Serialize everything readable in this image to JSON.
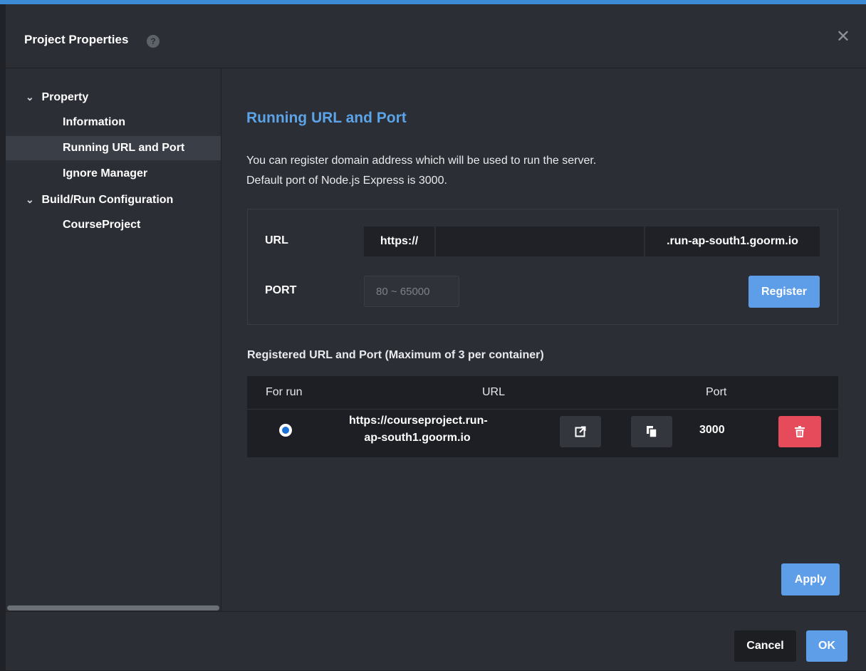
{
  "dialog": {
    "title": "Project Properties",
    "help_icon": "question-circle-icon",
    "close_icon": "close-x-icon"
  },
  "sidebar": {
    "groups": [
      {
        "label": "Property",
        "expanded": true,
        "items": [
          {
            "label": "Information",
            "active": false
          },
          {
            "label": "Running URL and Port",
            "active": true
          },
          {
            "label": "Ignore Manager",
            "active": false
          }
        ]
      },
      {
        "label": "Build/Run Configuration",
        "expanded": true,
        "items": [
          {
            "label": "CourseProject",
            "active": false
          }
        ]
      }
    ]
  },
  "main": {
    "title": "Running URL and Port",
    "description_line1": "You can register domain address which will be used to run the server.",
    "description_line2": "Default port of Node.js Express is 3000.",
    "form": {
      "url_label": "URL",
      "url_prefix": "https://",
      "url_value": "",
      "url_suffix": ".run-ap-south1.goorm.io",
      "port_label": "PORT",
      "port_placeholder": "80 ~ 65000",
      "register_label": "Register"
    },
    "registered_title": "Registered URL and Port (Maximum of 3 per container)",
    "table": {
      "headers": {
        "for_run": "For run",
        "url": "URL",
        "port": "Port"
      },
      "rows": [
        {
          "selected": true,
          "url_line1": "https://courseproject.run-",
          "url_line2": "ap-south1.goorm.io",
          "port": "3000",
          "open_icon": "external-link-icon",
          "copy_icon": "copy-icon",
          "delete_icon": "trash-icon"
        }
      ]
    },
    "apply_label": "Apply"
  },
  "footer": {
    "cancel_label": "Cancel",
    "ok_label": "OK"
  },
  "colors": {
    "accent": "#5e9ee8",
    "title_blue": "#5ca3e8",
    "danger": "#e54b5a",
    "background": "#2b2e34"
  }
}
